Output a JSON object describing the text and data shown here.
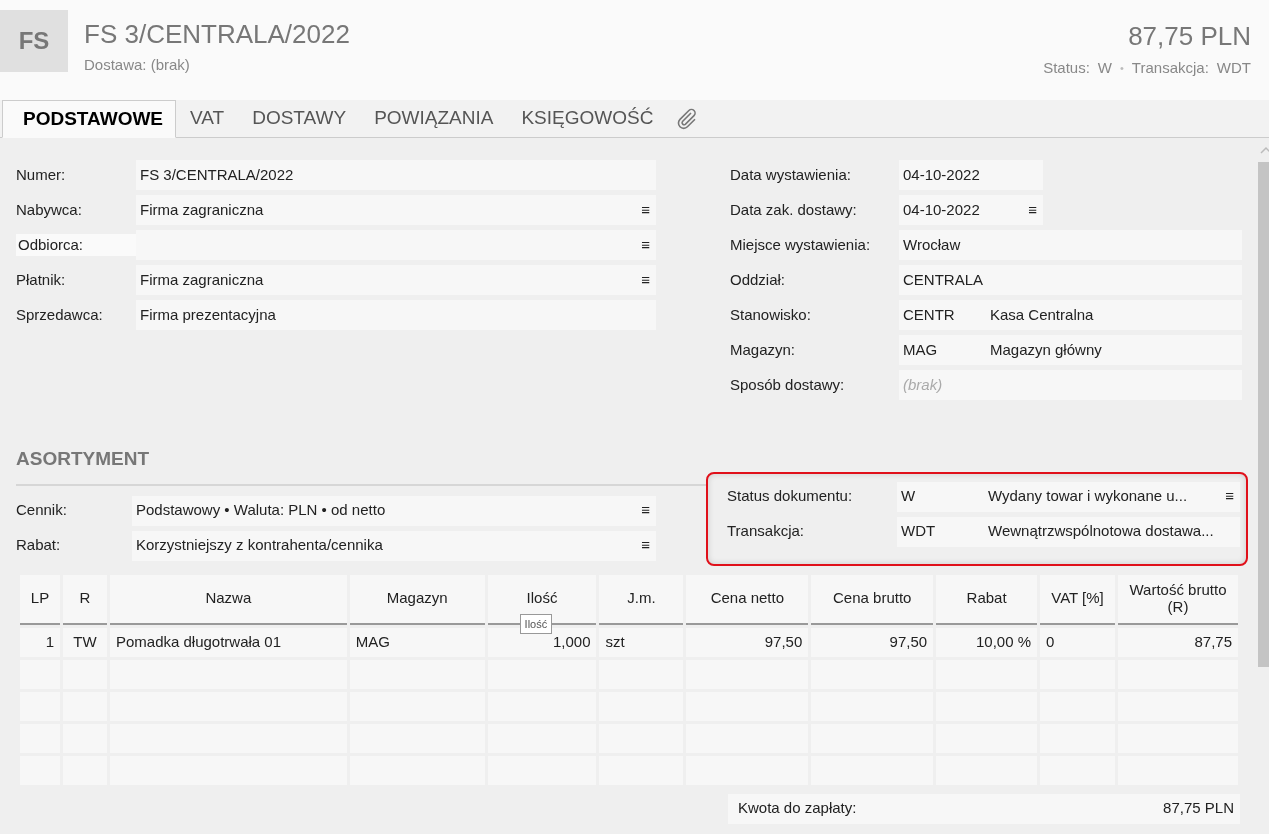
{
  "header": {
    "badge": "FS",
    "title": "FS 3/CENTRALA/2022",
    "subtitle": "Dostawa: (brak)",
    "amount": "87,75 PLN",
    "status_label": "Status:",
    "status_value": "W",
    "separator": "•",
    "transaction_label": "Transakcja:",
    "transaction_value": "WDT"
  },
  "tabs": [
    {
      "label": "PODSTAWOWE",
      "selected": true
    },
    {
      "label": "VAT",
      "selected": false
    },
    {
      "label": "DOSTAWY",
      "selected": false
    },
    {
      "label": "POWIĄZANIA",
      "selected": false
    },
    {
      "label": "KSIĘGOWOŚĆ",
      "selected": false
    }
  ],
  "left_fields": [
    {
      "label": "Numer:",
      "value": "FS 3/CENTRALA/2022",
      "focused": false
    },
    {
      "label": "Nabywca:",
      "value": "Firma zagraniczna",
      "menu_icon": "≡",
      "focused": false
    },
    {
      "label": "Odbiorca:",
      "menu_icon": "≡",
      "focused": true
    },
    {
      "label": "Płatnik:",
      "value": "Firma zagraniczna",
      "menu_icon": "≡",
      "focused": false
    },
    {
      "label": "Sprzedawca:",
      "value": "Firma prezentacyjna",
      "focused": false
    }
  ],
  "right_fields": [
    {
      "kind": "date",
      "label": "Data wystawienia:",
      "value": "04-10-2022"
    },
    {
      "kind": "date",
      "label": "Data zak. dostawy:",
      "value": "04-10-2022",
      "menu_icon": "≡"
    },
    {
      "kind": "text",
      "label": "Miejsce wystawienia:",
      "value": "Wrocław"
    },
    {
      "kind": "text",
      "label": "Oddział:",
      "value": "CENTRALA"
    },
    {
      "kind": "code",
      "label": "Stanowisko:",
      "code": "CENTR",
      "value": "Kasa Centralna"
    },
    {
      "kind": "code",
      "label": "Magazyn:",
      "code": "MAG",
      "value": "Magazyn główny"
    },
    {
      "kind": "text",
      "label": "Sposób dostawy:",
      "placeholder": "(brak)"
    }
  ],
  "section_title": "ASORTYMENT",
  "pricing_fields": [
    {
      "label": "Cennik:",
      "value": "Podstawowy • Waluta: PLN • od netto",
      "menu_icon": "≡"
    },
    {
      "label": "Rabat:",
      "value": "Korzystniejszy z kontrahenta/cennika",
      "menu_icon": "≡"
    }
  ],
  "status_group": {
    "highlighted": true,
    "fields": [
      {
        "label": "Status dokumentu:",
        "code": "W",
        "value": "Wydany towar i wykonane u...",
        "menu_icon": "≡"
      },
      {
        "label": "Transakcja:",
        "code": "WDT",
        "value": "Wewnątrzwspólnotowa dostawa..."
      }
    ]
  },
  "table": {
    "columns": [
      {
        "label": "LP",
        "kind": "right"
      },
      {
        "label": "R",
        "kind": "center"
      },
      {
        "label": "Nazwa",
        "kind": "left"
      },
      {
        "label": "Magazyn",
        "kind": "left"
      },
      {
        "label": "Ilość",
        "kind": "right"
      },
      {
        "label": "J.m.",
        "kind": "left"
      },
      {
        "label": "Cena netto",
        "kind": "right"
      },
      {
        "label": "Cena brutto",
        "kind": "right"
      },
      {
        "label": "Rabat",
        "kind": "right"
      },
      {
        "label": "VAT [%]",
        "kind": "left"
      },
      {
        "label": "Wartość brutto (R)",
        "kind": "right"
      }
    ],
    "rows": [
      [
        "1",
        "TW",
        "Pomadka długotrwała 01",
        "MAG",
        "1,000",
        "szt",
        "97,50",
        "97,50",
        "10,00 %",
        "0",
        "87,75"
      ]
    ]
  },
  "tooltip": {
    "text": "Ilość"
  },
  "total": {
    "label": "Kwota do zapłaty:",
    "value": "87,75 PLN"
  }
}
